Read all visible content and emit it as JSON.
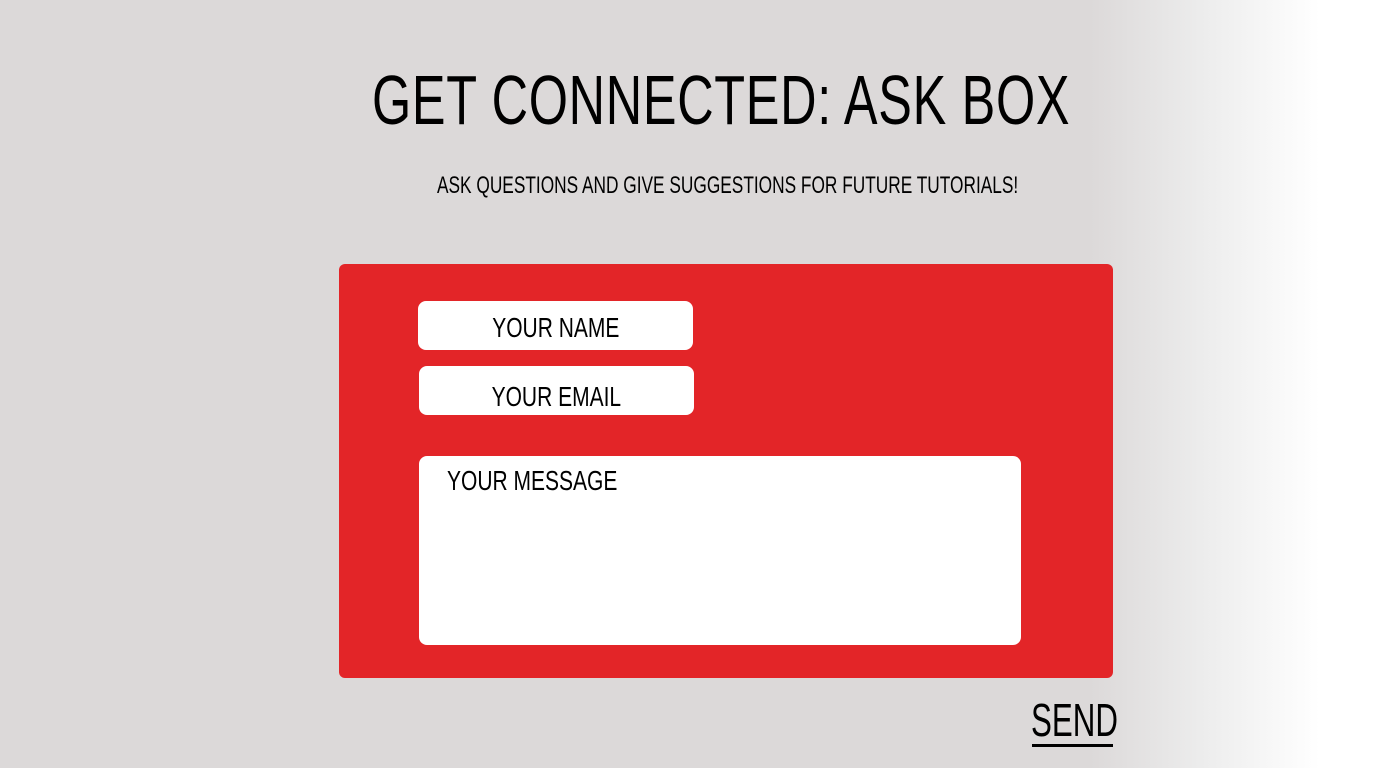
{
  "header": {
    "title": "Get Connected: Ask Box",
    "subtitle": "Ask questions and give suggestions for future tutorials!"
  },
  "form": {
    "panel_color": "#e32528",
    "name_placeholder": "Your Name",
    "email_placeholder": "Your Email",
    "message_placeholder": "Your Message",
    "send_label": "Send"
  }
}
